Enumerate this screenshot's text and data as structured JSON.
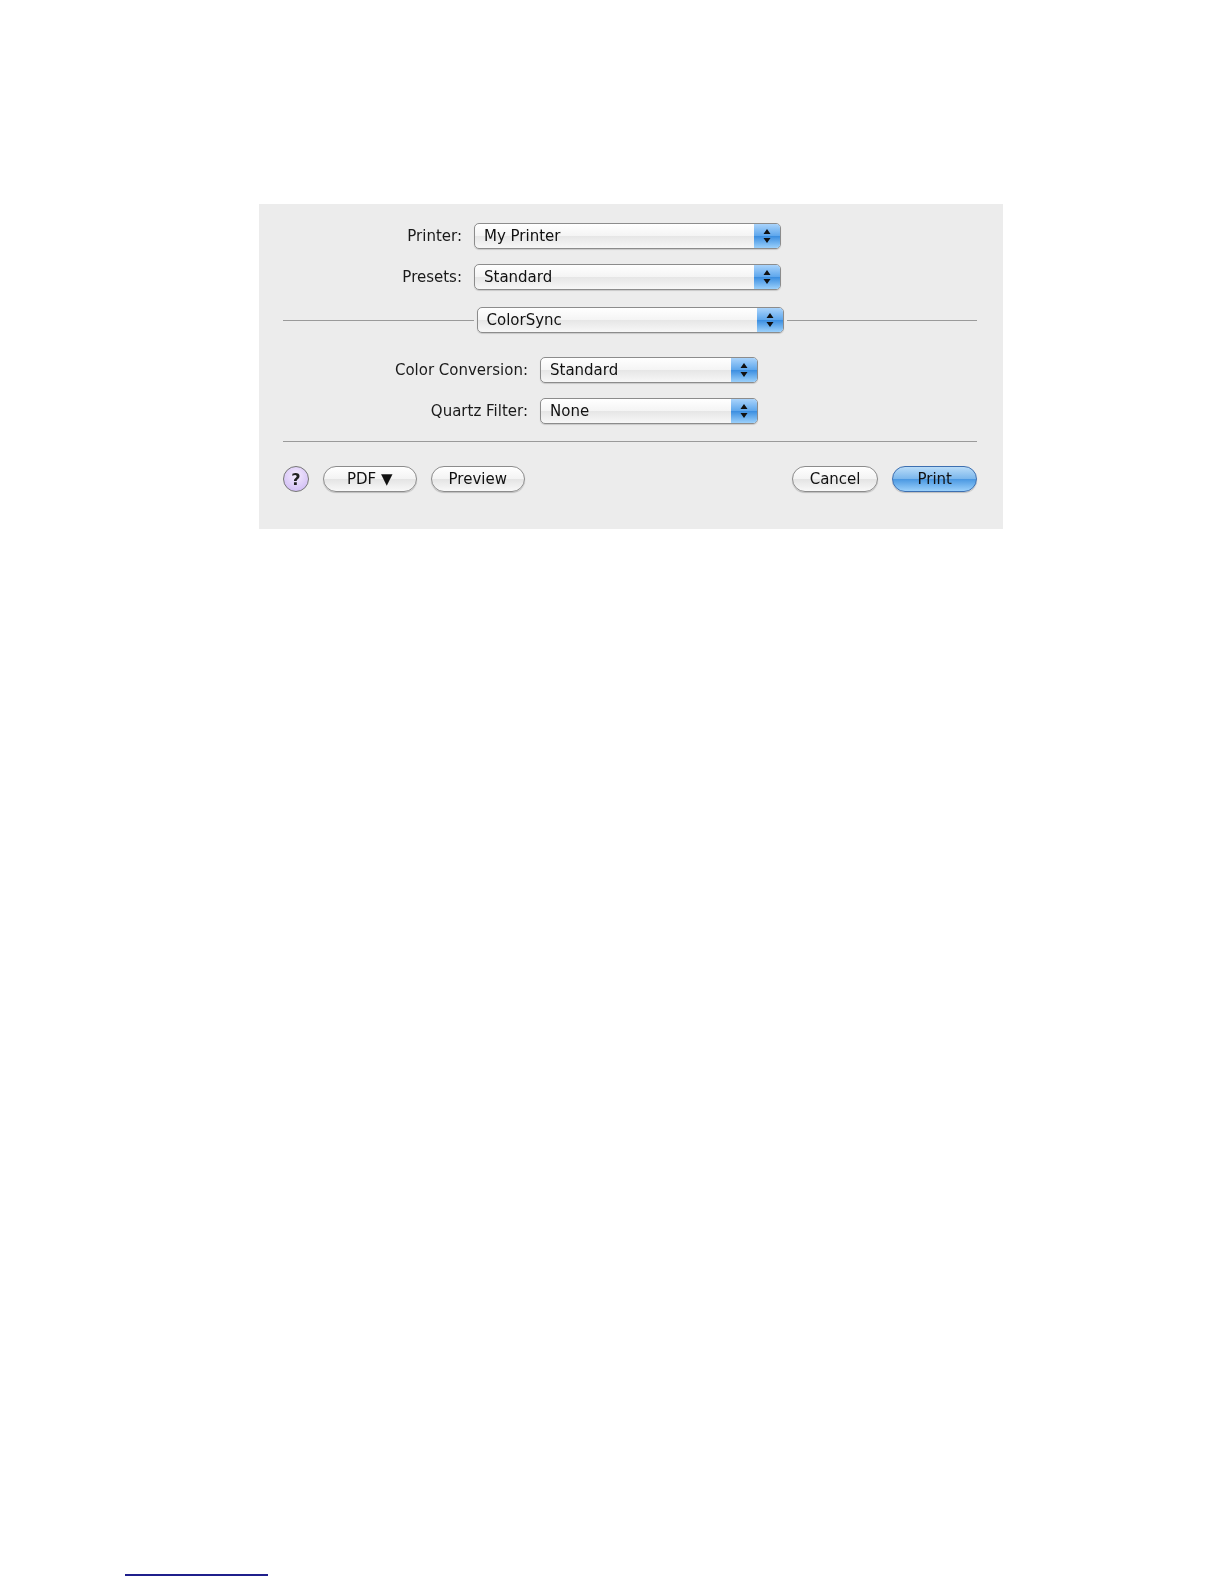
{
  "dialog": {
    "fields": [
      {
        "label": "Printer:",
        "value": "My Printer"
      },
      {
        "label": "Presets:",
        "value": "Standard"
      }
    ],
    "pane_menu": {
      "value": "ColorSync"
    },
    "pane_fields": [
      {
        "label": "Color Conversion:",
        "value": "Standard"
      },
      {
        "label": "Quartz Filter:",
        "value": "None"
      }
    ],
    "left_buttons": [
      {
        "kind": "help",
        "label": "?"
      },
      {
        "kind": "menu",
        "label": "PDF ▼"
      },
      {
        "kind": "push",
        "label": "Preview"
      }
    ],
    "right_buttons": [
      {
        "kind": "push",
        "label": "Cancel"
      },
      {
        "kind": "default",
        "label": "Print"
      }
    ]
  }
}
